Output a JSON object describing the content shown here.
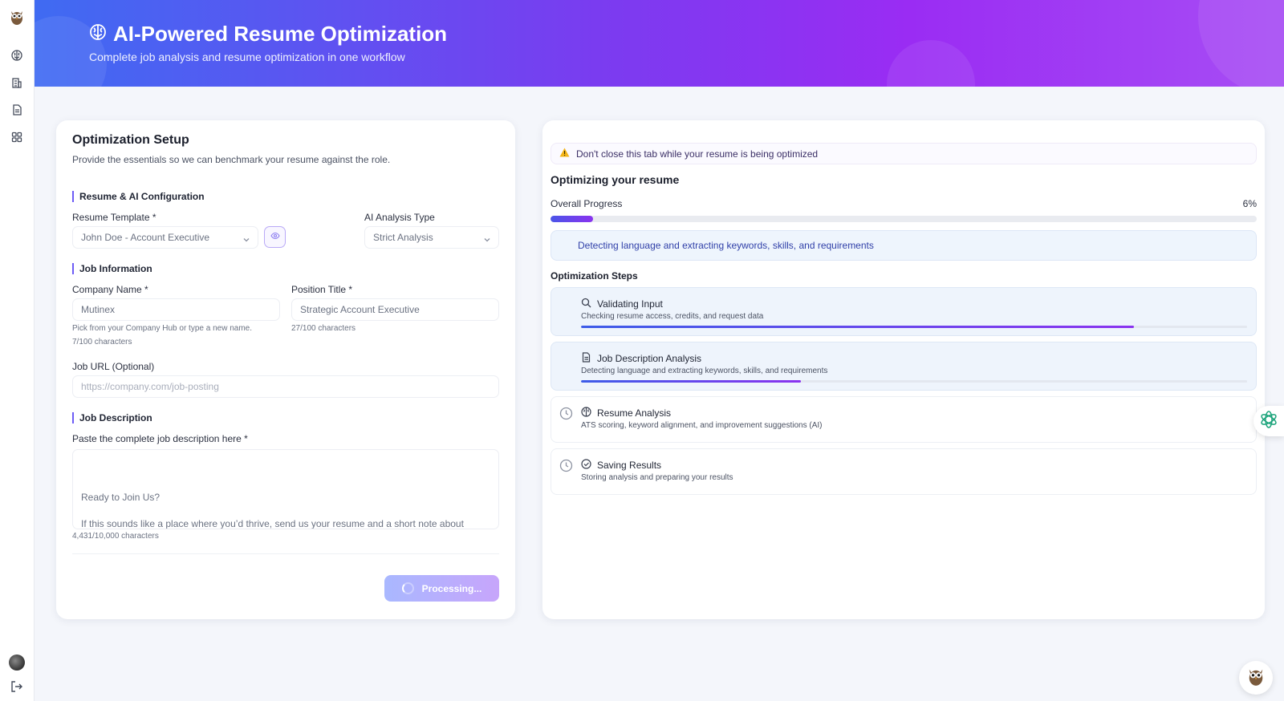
{
  "header": {
    "title": "AI-Powered Resume Optimization",
    "subtitle": "Complete job analysis and resume optimization in one workflow"
  },
  "setup": {
    "title": "Optimization Setup",
    "subtitle": "Provide the essentials so we can benchmark your resume against the role.",
    "section_resume": "Resume & AI Configuration",
    "resume_template_label": "Resume Template *",
    "resume_template_value": "John Doe - Account Executive",
    "ai_type_label": "AI Analysis Type",
    "ai_type_value": "Strict Analysis",
    "section_job": "Job Information",
    "company_label": "Company Name *",
    "company_value": "Mutinex",
    "company_hint": "Pick from your Company Hub or type a new name.",
    "company_count": "7/100 characters",
    "position_label": "Position Title *",
    "position_value": "Strategic Account Executive",
    "position_count": "27/100 characters",
    "job_url_label": "Job URL (Optional)",
    "job_url_placeholder": "https://company.com/job-posting",
    "section_desc": "Job Description",
    "desc_label": "Paste the complete job description here *",
    "desc_line1": "Ready to Join Us?",
    "desc_line2": "If this sounds like a place where you’d thrive, send us your resume and a short note about",
    "desc_count": "4,431/10,000 characters",
    "processing_label": "Processing..."
  },
  "progress": {
    "warning": "Don't close this tab while your resume is being optimized",
    "title": "Optimizing your resume",
    "overall_label": "Overall Progress",
    "overall_percent": "6%",
    "overall_value": 0.06,
    "status": "Detecting language and extracting keywords, skills, and requirements",
    "steps_title": "Optimization Steps",
    "steps": [
      {
        "name": "Validating Input",
        "desc": "Checking resume access, credits, and request data",
        "icon": "search-icon",
        "progress": 0.83,
        "active": true
      },
      {
        "name": "Job Description Analysis",
        "desc": "Detecting language and extracting keywords, skills, and requirements",
        "icon": "document-icon",
        "progress": 0.33,
        "active": true
      },
      {
        "name": "Resume Analysis",
        "desc": "ATS scoring, keyword alignment, and improvement suggestions (AI)",
        "icon": "brain-icon",
        "progress": 0,
        "active": false
      },
      {
        "name": "Saving Results",
        "desc": "Storing analysis and preparing your results",
        "icon": "check-circle-icon",
        "progress": 0,
        "active": false
      }
    ]
  },
  "colors": {
    "accent": "#6d5cf6",
    "banner_start": "#3f6bf2",
    "banner_end": "#a74df4"
  }
}
